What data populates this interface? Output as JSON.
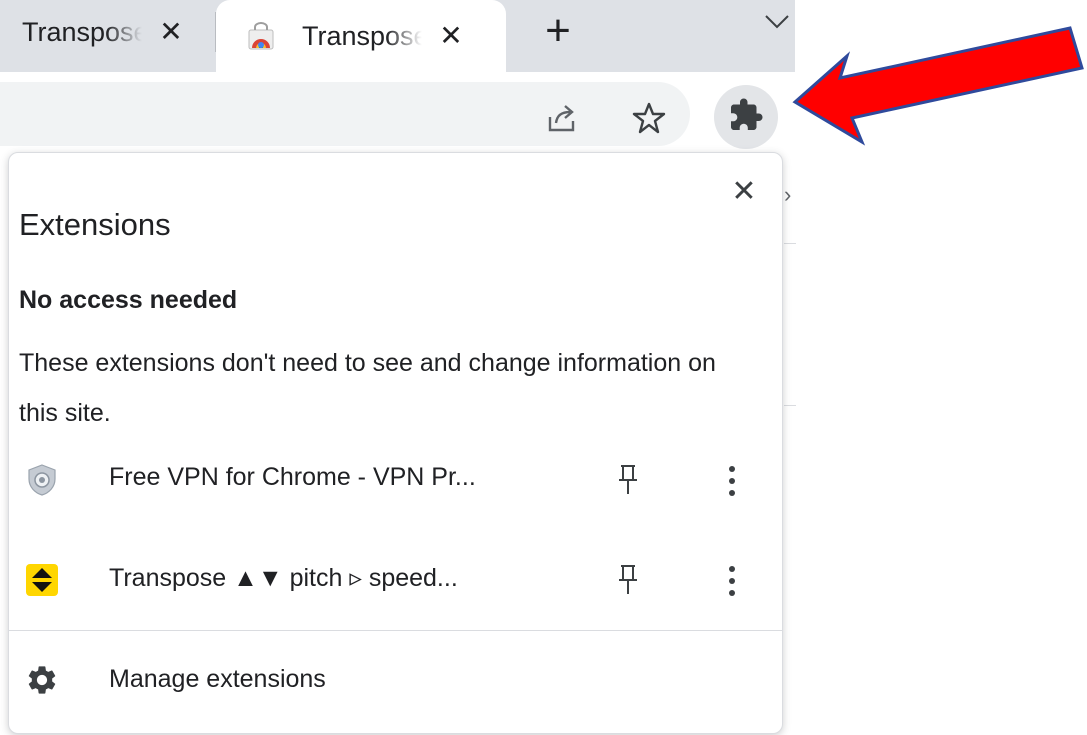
{
  "tabs": [
    {
      "title": "Transpose ▲▼ pitch ▹ speed",
      "close_glyph": "✕",
      "active": false
    },
    {
      "title": "Transpose ▲▼ pitch ▹ speed",
      "close_glyph": "✕",
      "active": true,
      "favicon": "chrome-web-store-icon"
    }
  ],
  "newtab_glyph": "+",
  "toolbar": {
    "share_icon": "share-icon",
    "bookmark_icon": "star-icon",
    "extensions_icon": "puzzle-icon"
  },
  "popup": {
    "title": "Extensions",
    "close_glyph": "✕",
    "section_heading": "No access needed",
    "section_description": "These extensions don't need to see and change information on this site.",
    "extensions": [
      {
        "name": "Free VPN for Chrome - VPN Pr...",
        "icon": "vpn-shield-icon"
      },
      {
        "name": "Transpose ▲▼ pitch ▹ speed...",
        "icon": "transpose-icon"
      }
    ],
    "manage_label": "Manage extensions"
  },
  "colors": {
    "tabstrip": "#dee1e6",
    "omnibox": "#f1f3f4",
    "arrow_fill": "#ff0000",
    "arrow_stroke": "#2f4a9c",
    "transpose_yellow": "#ffd600"
  }
}
